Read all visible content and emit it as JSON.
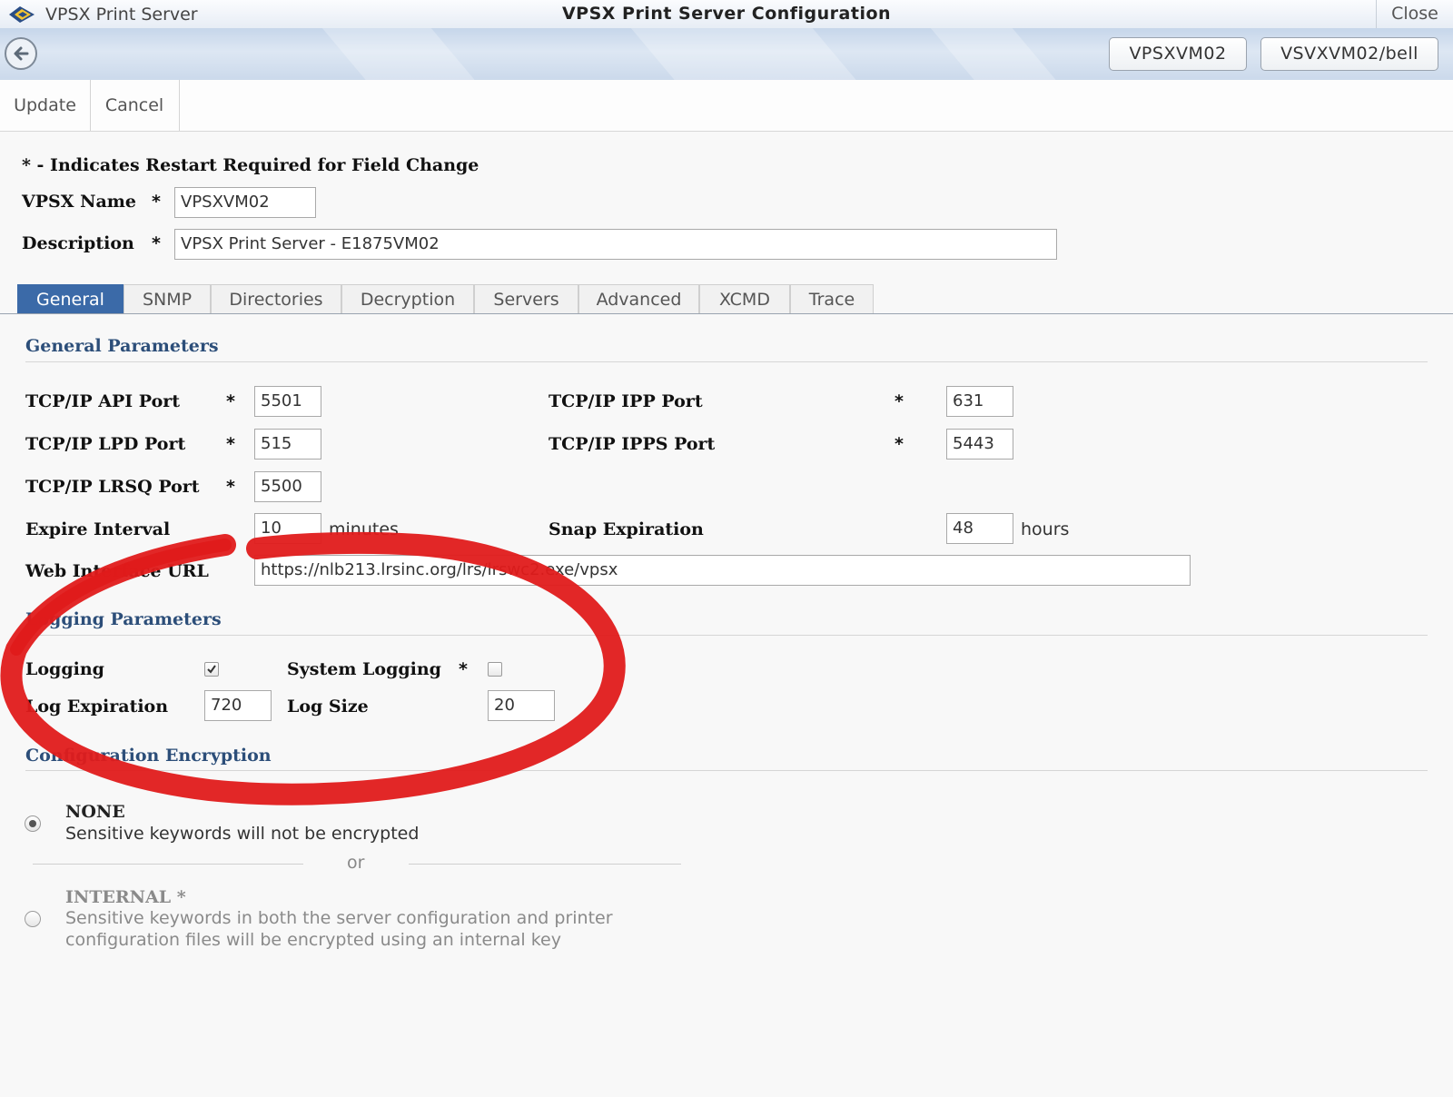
{
  "window": {
    "app_name": "VPSX Print Server",
    "title": "VPSX Print Server Configuration",
    "close_label": "Close"
  },
  "nav": {
    "server_button": "VPSXVM02",
    "user_button": "VSVXVM02/bell"
  },
  "toolbar": {
    "update_label": "Update",
    "cancel_label": "Cancel"
  },
  "header": {
    "restart_note": "* - Indicates Restart Required for Field Change",
    "name_label": "VPSX Name",
    "name_value": "VPSXVM02",
    "description_label": "Description",
    "description_value": "VPSX Print Server - E1875VM02",
    "required_star": "*"
  },
  "tabs": [
    {
      "label": "General",
      "active": true
    },
    {
      "label": "SNMP"
    },
    {
      "label": "Directories"
    },
    {
      "label": "Decryption"
    },
    {
      "label": "Servers"
    },
    {
      "label": "Advanced"
    },
    {
      "label": "XCMD"
    },
    {
      "label": "Trace"
    }
  ],
  "general": {
    "section_title": "General Parameters",
    "api_port": {
      "label": "TCP/IP API Port",
      "value": "5501"
    },
    "lpd_port": {
      "label": "TCP/IP LPD Port",
      "value": "515"
    },
    "lrsq_port": {
      "label": "TCP/IP LRSQ Port",
      "value": "5500"
    },
    "ipp_port": {
      "label": "TCP/IP IPP Port",
      "value": "631"
    },
    "ipps_port": {
      "label": "TCP/IP IPPS Port",
      "value": "5443"
    },
    "expire_interval": {
      "label": "Expire Interval",
      "value": "10",
      "unit": "minutes"
    },
    "snap_expiration": {
      "label": "Snap Expiration",
      "value": "48",
      "unit": "hours"
    },
    "web_url": {
      "label": "Web Interface URL",
      "value": "https://nlb213.lrsinc.org/lrs/lrswc2.exe/vpsx"
    }
  },
  "logging": {
    "section_title": "Logging Parameters",
    "logging_label": "Logging",
    "logging_checked": true,
    "system_logging_label": "System Logging",
    "system_logging_checked": false,
    "log_expiration": {
      "label": "Log Expiration",
      "value": "720"
    },
    "log_size": {
      "label": "Log Size",
      "value": "20"
    }
  },
  "encryption": {
    "section_title": "Configuration Encryption",
    "none": {
      "title": "NONE",
      "desc1": "Sensitive keywords will not be encrypted",
      "selected": true
    },
    "or_text": "or",
    "internal": {
      "title": "INTERNAL *",
      "desc1": "Sensitive keywords in both the server configuration and printer",
      "desc2": "configuration files will be encrypted using an internal key",
      "selected": false
    }
  },
  "colors": {
    "active_tab": "#3b6aa8",
    "section_title": "#2c4e79",
    "annotation_red": "#e01b1b"
  }
}
